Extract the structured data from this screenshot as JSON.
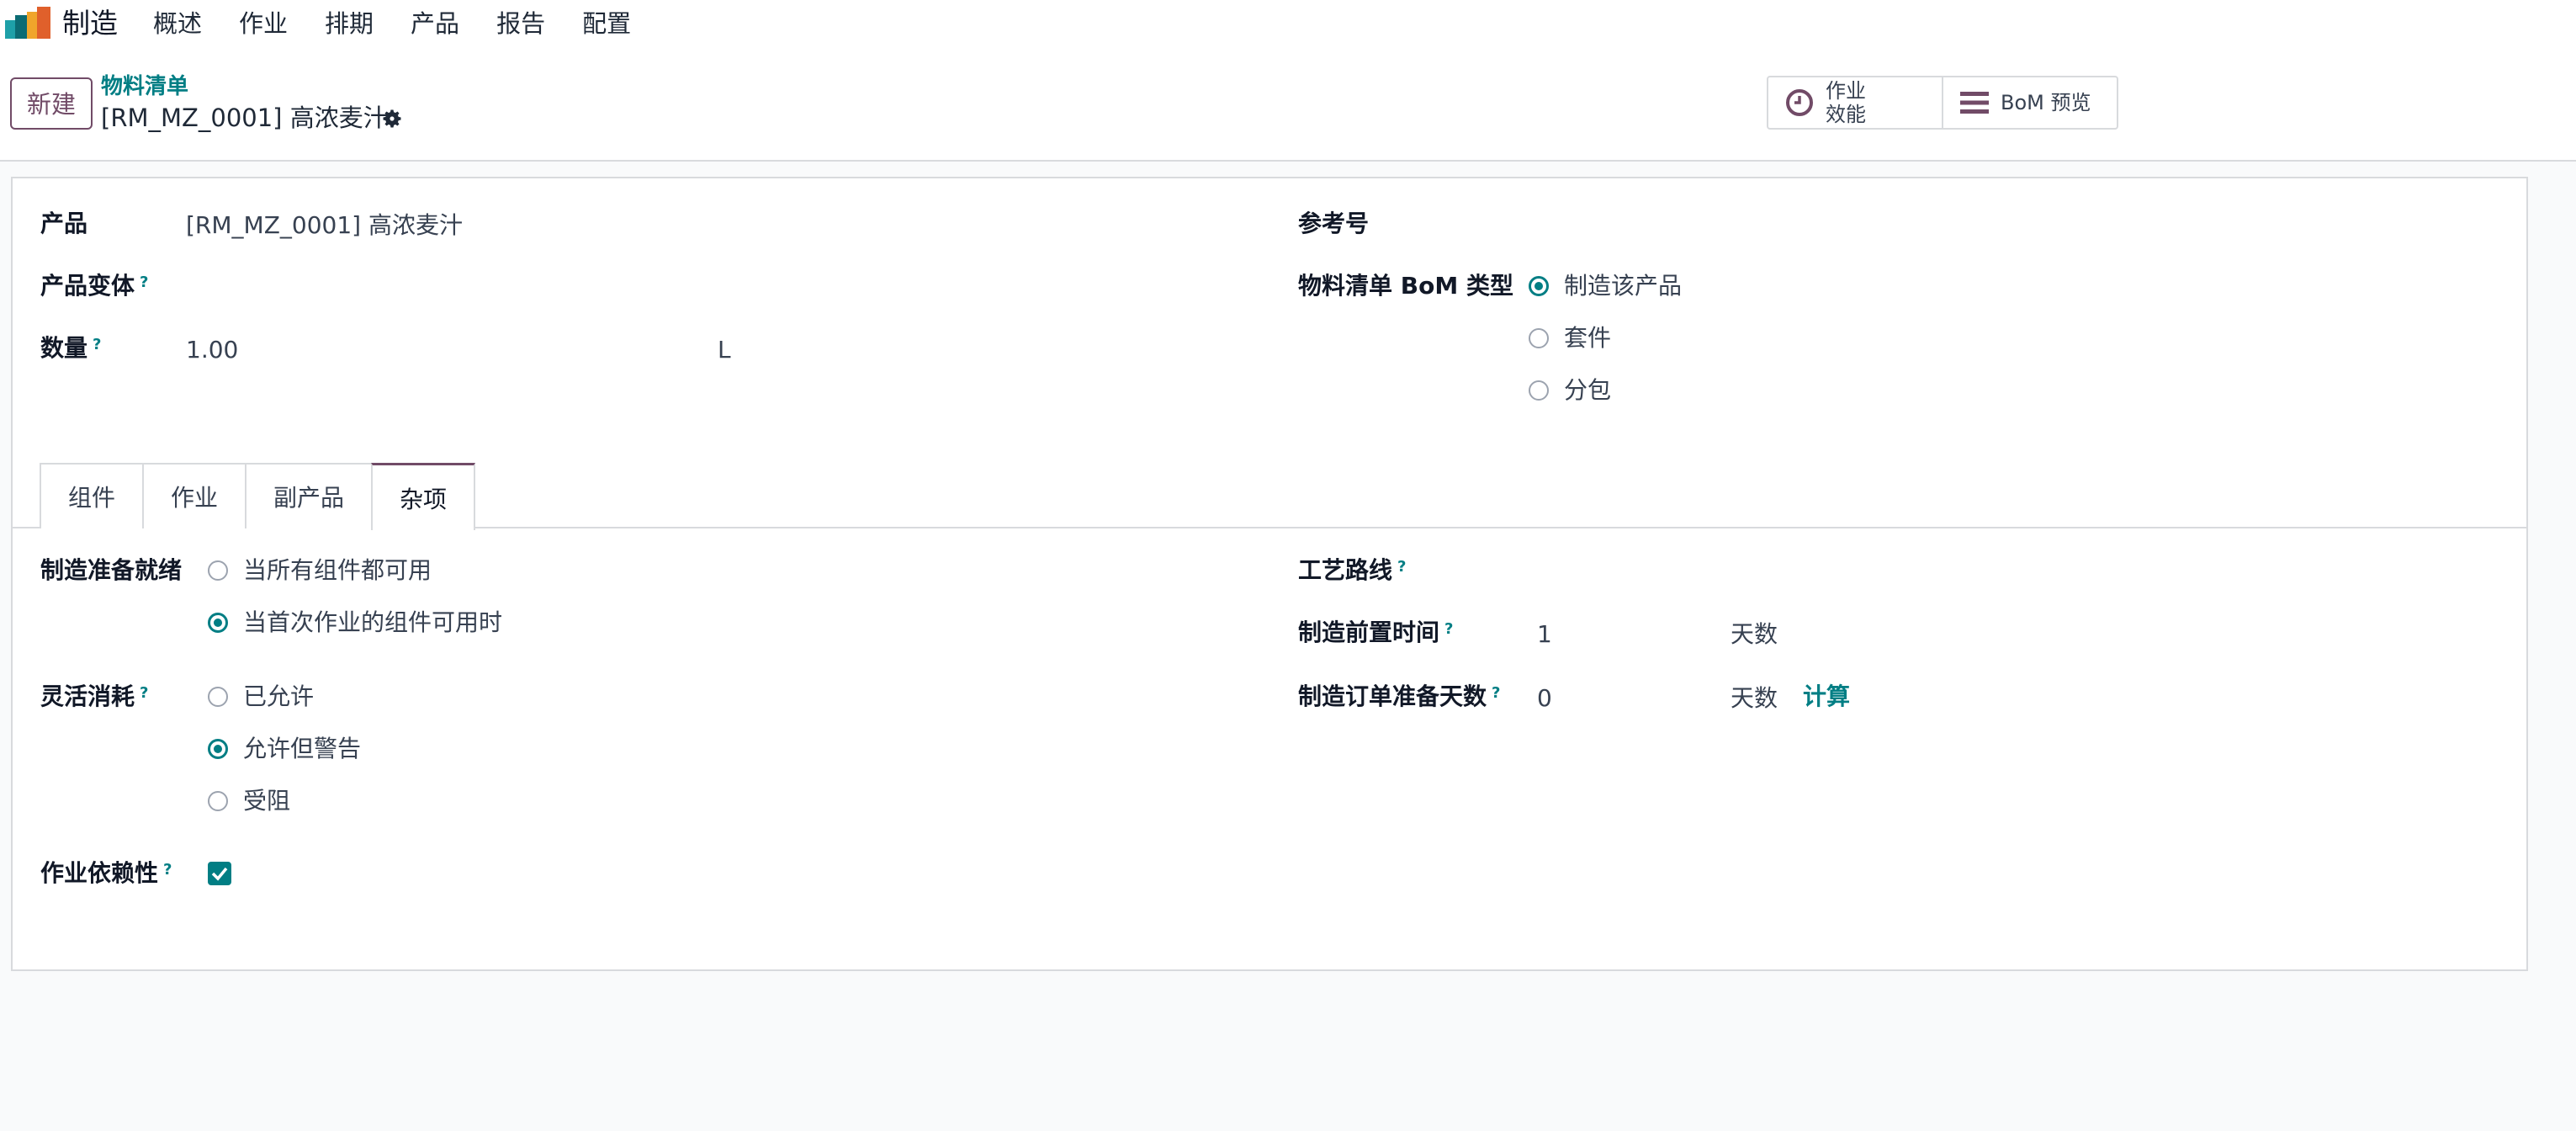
{
  "app": {
    "name": "制造",
    "brand_color": "#714b67",
    "accent_color": "#017e84"
  },
  "menu": [
    "概述",
    "作业",
    "排期",
    "产品",
    "报告",
    "配置"
  ],
  "control": {
    "new_label": "新建",
    "breadcrumb_parent": "物料清单",
    "breadcrumb_current": "[RM_MZ_0001] 高浓麦汁",
    "smart_buttons": [
      {
        "line1": "作业",
        "line2": "效能",
        "icon": "clock-icon"
      },
      {
        "line1": "BoM 预览",
        "line2": "",
        "icon": "bars-icon"
      }
    ]
  },
  "form": {
    "product_label": "产品",
    "product_value": "[RM_MZ_0001] 高浓麦汁",
    "variant_label": "产品变体",
    "qty_label": "数量",
    "qty_value": "1.00",
    "uom_value": "L",
    "ref_label": "参考号",
    "bom_type_label": "物料清单 BoM 类型",
    "bom_type_options": [
      "制造该产品",
      "套件",
      "分包"
    ],
    "bom_type_selected": 0,
    "help_mark": "?"
  },
  "tabs": {
    "items": [
      "组件",
      "作业",
      "副产品",
      "杂项"
    ],
    "active": 3
  },
  "misc": {
    "ready_label": "制造准备就绪",
    "ready_options": [
      "当所有组件都可用",
      "当首次作业的组件可用时"
    ],
    "ready_selected": 1,
    "flex_label": "灵活消耗",
    "flex_options": [
      "已允许",
      "允许但警告",
      "受阻"
    ],
    "flex_selected": 1,
    "dep_label": "作业依赖性",
    "dep_checked": true,
    "route_label": "工艺路线",
    "lead_label": "制造前置时间",
    "lead_value": "1",
    "lead_unit": "天数",
    "prep_label": "制造订单准备天数",
    "prep_value": "0",
    "prep_unit": "天数",
    "compute_label": "计算"
  }
}
